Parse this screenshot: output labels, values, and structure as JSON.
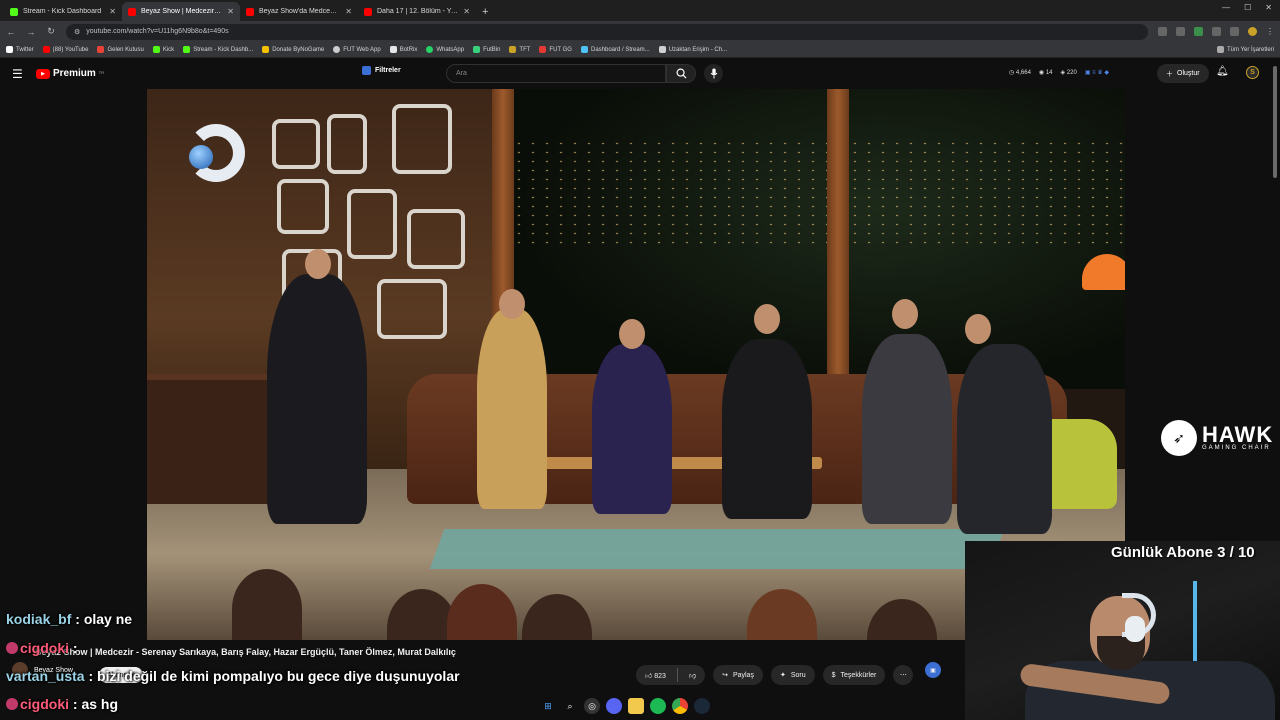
{
  "browser": {
    "tabs": [
      {
        "label": "Stream - Kick Dashboard",
        "color": "#53fc18"
      },
      {
        "label": "Beyaz Show | Medcezir - Serenay",
        "color": "#ff0000"
      },
      {
        "label": "Beyaz Show'da Medcezir skeç",
        "color": "#ff0000"
      },
      {
        "label": "Daha 17 | 12. Bölüm - YouTube",
        "color": "#ff0000"
      }
    ],
    "url": "youtube.com/watch?v=U11hg6N9b8o&t=490s",
    "bookmarks": [
      {
        "label": "Twitter",
        "color": "#ffffff"
      },
      {
        "label": "(88) YouTube",
        "color": "#ff0000"
      },
      {
        "label": "Gelen Kutusu",
        "color": "#ea4335"
      },
      {
        "label": "Kick",
        "color": "#53fc18"
      },
      {
        "label": "Stream - Kick Dashb...",
        "color": "#53fc18"
      },
      {
        "label": "Donate ByNoGame",
        "color": "#f2c200"
      },
      {
        "label": "FUT Web App",
        "color": "#cccccc"
      },
      {
        "label": "BotRix",
        "color": "#e6e6e6"
      },
      {
        "label": "WhatsApp",
        "color": "#25d366"
      },
      {
        "label": "FutBin",
        "color": "#3ad17c"
      },
      {
        "label": "TFT",
        "color": "#c9a227"
      },
      {
        "label": "FUT GG",
        "color": "#e53935"
      },
      {
        "label": "Dashboard / Stream...",
        "color": "#4fc3f7"
      },
      {
        "label": "Uzaktan Erişim - Ch...",
        "color": "#cfcfcf"
      }
    ],
    "bookmarks_right": "Tüm Yer İşaretleri"
  },
  "youtube": {
    "logo_word": "Premium",
    "logo_cc": "TR",
    "filter_label": "Filtreler",
    "search_placeholder": "Ara",
    "stats": [
      "4,664",
      "14",
      "220"
    ],
    "create_label": "Oluştur",
    "avatar_letter": "S",
    "video_title": "Beyaz Show | Medcezir - Serenay Sarıkaya, Barış Falay, Hazar Ergüçlü, Taner Ölmez, Murat Dalkılıç",
    "channel_name": "Beyaz Show",
    "subscribe_label": "Abone ol",
    "likes": "823",
    "share_label": "Paylaş",
    "ask_label": "Soru",
    "thanks_label": "Teşekkürler"
  },
  "overlay": {
    "sponsor_name": "HAWK",
    "sponsor_sub": "GAMING CHAIR",
    "goal_text": "Günlük Abone 3 / 10",
    "chat": [
      {
        "user": "kodiak_bf",
        "message": "olay ne",
        "color": "#9ad3e6"
      },
      {
        "user": "cigdoki",
        "message": "",
        "color": "#ff5c7a"
      },
      {
        "user": "vartan_usta",
        "message": "bizi değil de kimi pompalıyo bu gece diye duşunuyolar",
        "color": "#9ad3e6"
      },
      {
        "user": "cigdoki",
        "message": "as hg",
        "color": "#ff5c7a"
      }
    ]
  }
}
